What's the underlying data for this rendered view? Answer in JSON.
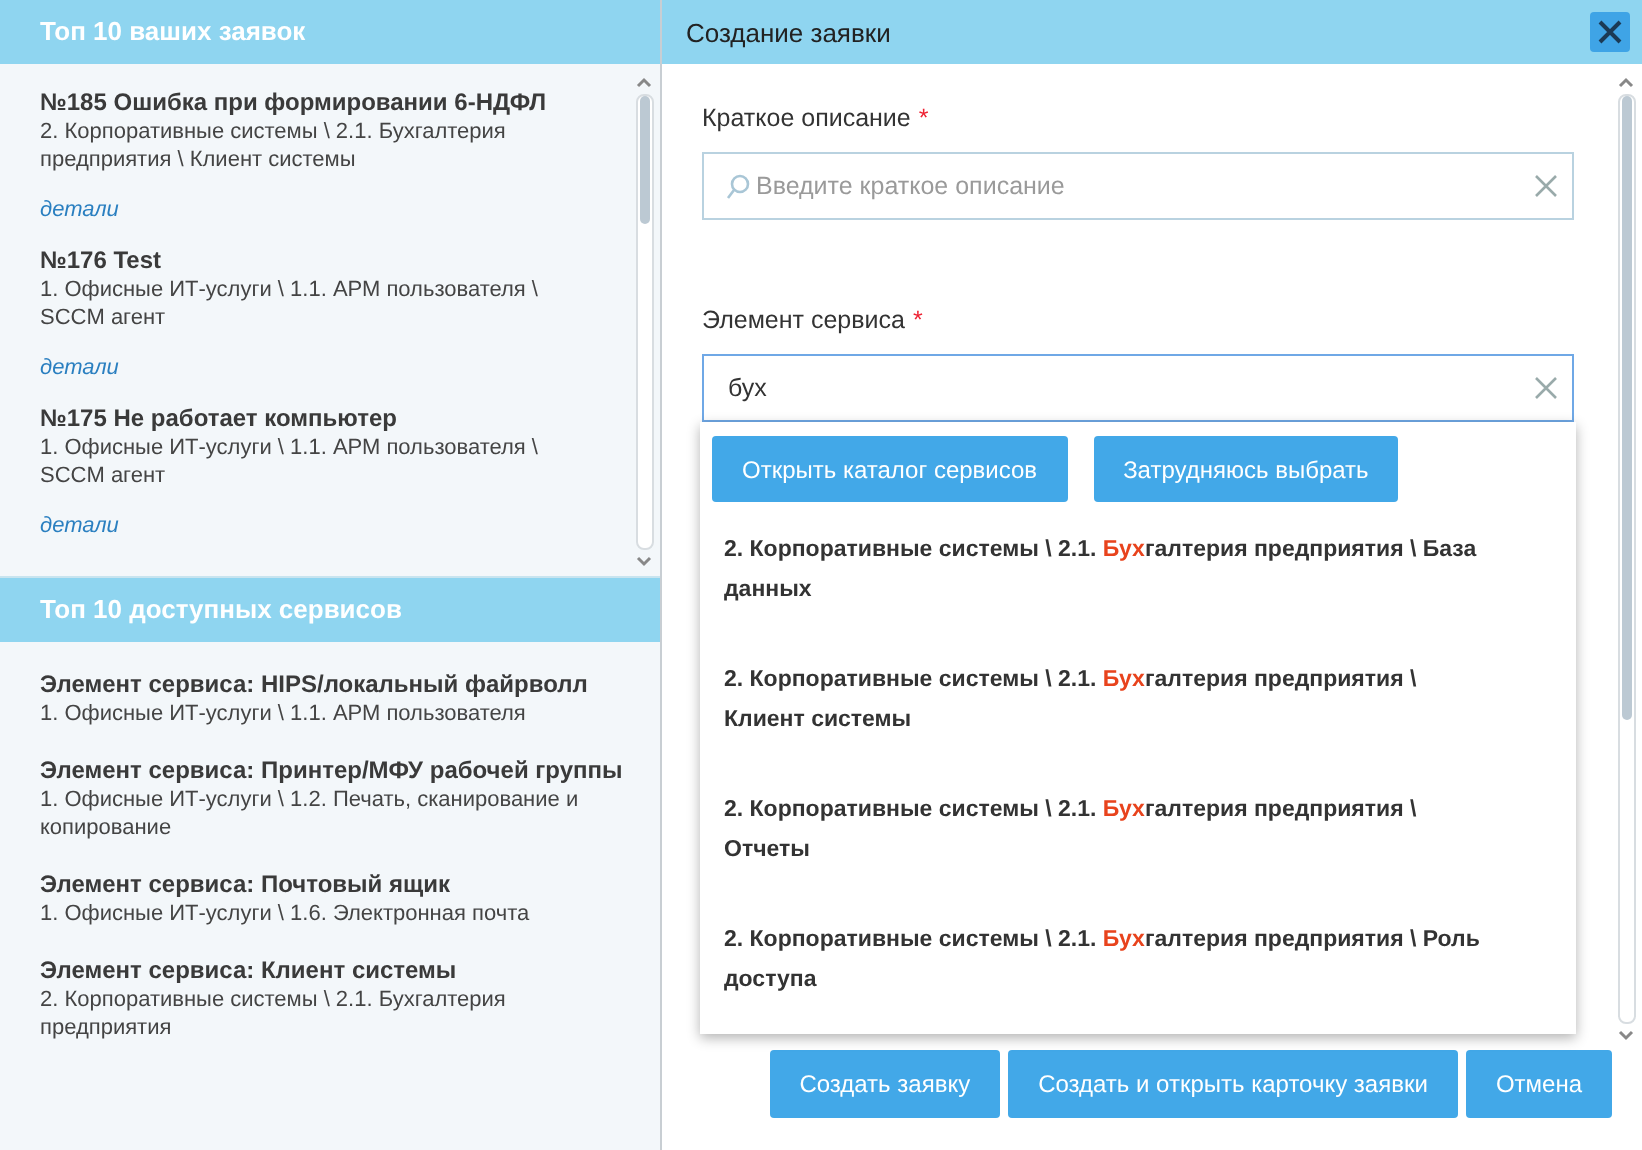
{
  "requests_panel": {
    "title": "Топ 10 ваших заявок",
    "items": [
      {
        "title": "№185 Ошибка при формировании 6-НДФЛ",
        "path": "2. Корпоративные системы \\ 2.1. Бухгалтерия предприятия \\ Клиент системы",
        "link": "детали"
      },
      {
        "title": "№176 Test",
        "path": "1. Офисные ИТ-услуги \\ 1.1. АРМ пользователя \\ SCCM агент",
        "link": "детали"
      },
      {
        "title": "№175 Не работает компьютер",
        "path": "1. Офисные ИТ-услуги \\ 1.1. АРМ пользователя \\ SCCM агент",
        "link": "детали"
      }
    ]
  },
  "services_panel": {
    "title": "Топ 10 доступных сервисов",
    "items": [
      {
        "title": "Элемент сервиса: HIPS/локальный файрволл",
        "path": "1. Офисные ИТ-услуги \\ 1.1. АРМ пользователя"
      },
      {
        "title": "Элемент сервиса: Принтер/МФУ рабочей группы",
        "path": "1. Офисные ИТ-услуги \\ 1.2. Печать, сканирование и копирование"
      },
      {
        "title": "Элемент сервиса: Почтовый ящик",
        "path": "1. Офисные ИТ-услуги \\ 1.6. Электронная почта"
      },
      {
        "title": "Элемент сервиса: Клиент системы",
        "path": "2. Корпоративные системы \\ 2.1. Бухгалтерия предприятия"
      }
    ]
  },
  "dialog": {
    "title": "Создание заявки",
    "fields": [
      {
        "label": "Краткое описание",
        "required_mark": "*",
        "placeholder": "Введите краткое описание",
        "focused": false
      },
      {
        "label": "Элемент сервиса",
        "required_mark": "*",
        "value": "бух",
        "focused": true
      }
    ],
    "dropdown": {
      "buttons": [
        "Открыть каталог сервисов",
        "Затрудняюсь выбрать"
      ],
      "suggestions": [
        {
          "before": "2. Корпоративные системы \\ 2.1. ",
          "match": "Бух",
          "after": "галтерия предприятия \\ База данных"
        },
        {
          "before": "2. Корпоративные системы \\ 2.1. ",
          "match": "Бух",
          "after": "галтерия предприятия \\ Клиент системы"
        },
        {
          "before": "2. Корпоративные системы \\ 2.1. ",
          "match": "Бух",
          "after": "галтерия предприятия \\ Отчеты"
        },
        {
          "before": "2. Корпоративные системы \\ 2.1. ",
          "match": "Бух",
          "after": "галтерия предприятия \\ Роль доступа"
        }
      ]
    },
    "buttons": [
      "Создать заявку",
      "Создать и открыть карточку заявки",
      "Отмена"
    ]
  }
}
